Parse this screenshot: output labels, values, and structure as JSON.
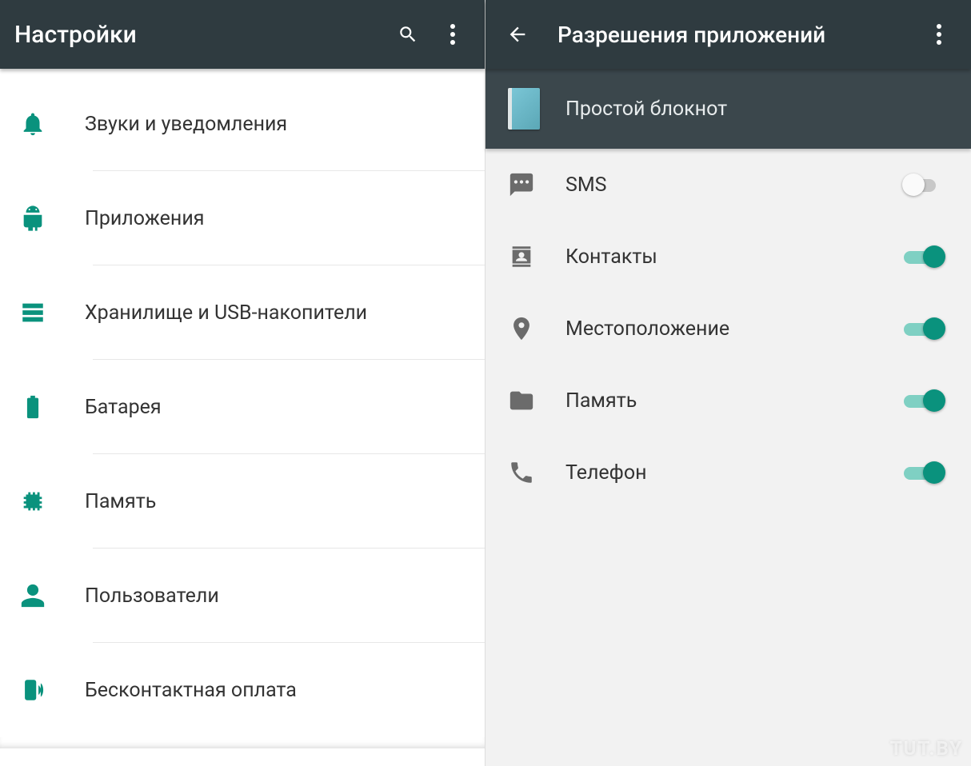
{
  "colors": {
    "accent": "#0a927d",
    "appbar_bg": "#2f3b40",
    "subbar_bg": "#3b474c"
  },
  "left": {
    "title": "Настройки",
    "items": [
      {
        "icon": "bell-icon",
        "label": "Звуки и уведомления"
      },
      {
        "icon": "android-icon",
        "label": "Приложения"
      },
      {
        "icon": "storage-icon",
        "label": "Хранилище и USB-накопители"
      },
      {
        "icon": "battery-icon",
        "label": "Батарея"
      },
      {
        "icon": "memory-icon",
        "label": "Память"
      },
      {
        "icon": "user-icon",
        "label": "Пользователи"
      },
      {
        "icon": "tap-and-pay-icon",
        "label": "Бесконтактная оплата"
      }
    ]
  },
  "right": {
    "title": "Разрешения приложений",
    "app_name": "Простой блокнот",
    "permissions": [
      {
        "icon": "sms-icon",
        "label": "SMS",
        "on": false
      },
      {
        "icon": "contacts-icon",
        "label": "Контакты",
        "on": true
      },
      {
        "icon": "location-icon",
        "label": "Местоположение",
        "on": true
      },
      {
        "icon": "folder-icon",
        "label": "Память",
        "on": true
      },
      {
        "icon": "phone-icon",
        "label": "Телефон",
        "on": true
      }
    ],
    "watermark": "TUT.BY"
  }
}
